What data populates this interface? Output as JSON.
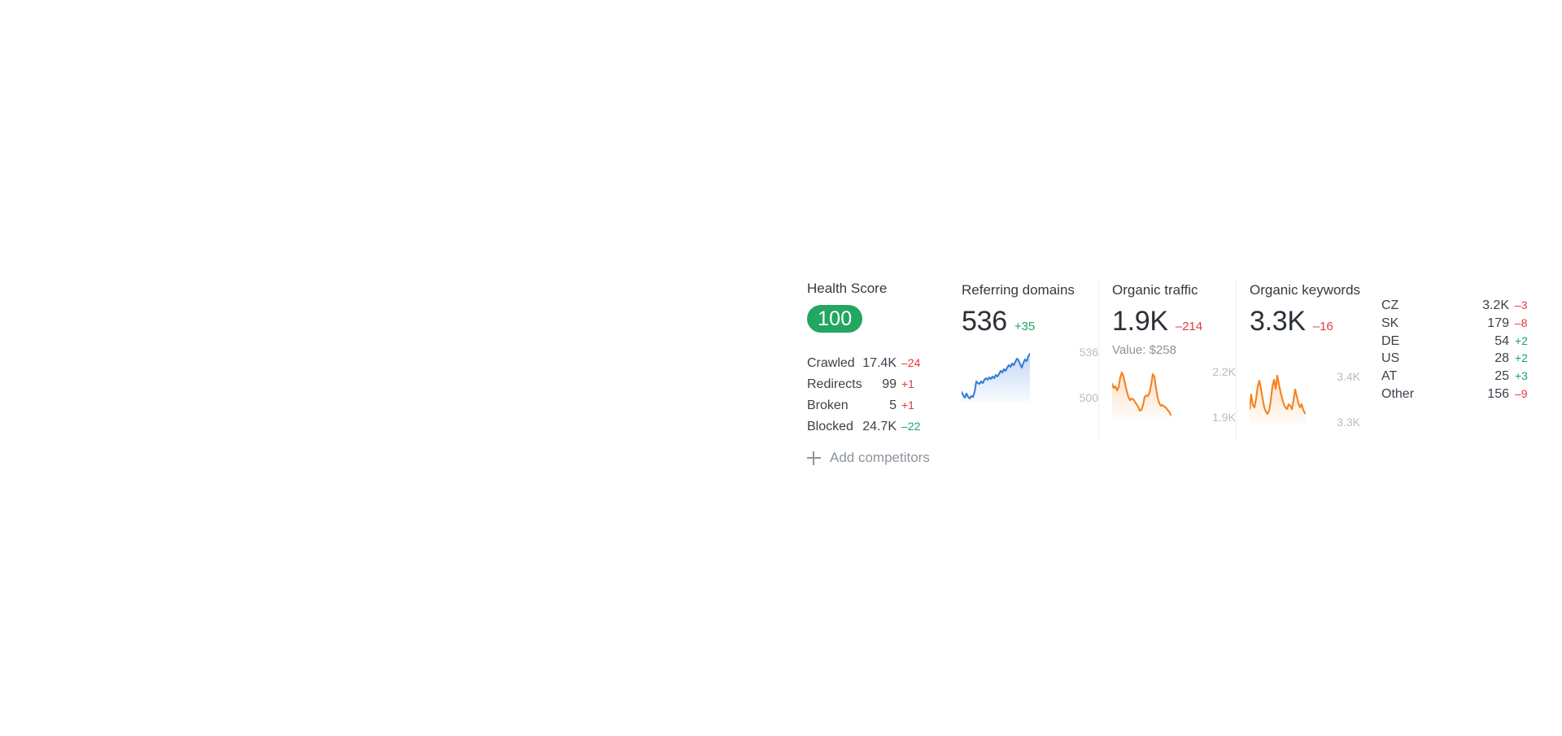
{
  "health": {
    "title": "Health Score",
    "score": "100",
    "score_color": "#22a661",
    "stats": [
      {
        "label": "Crawled",
        "value": "17.4K",
        "delta": "–24",
        "dir": "down"
      },
      {
        "label": "Redirects",
        "value": "99",
        "delta": "+1",
        "dir": "down"
      },
      {
        "label": "Broken",
        "value": "5",
        "delta": "+1",
        "dir": "down"
      },
      {
        "label": "Blocked",
        "value": "24.7K",
        "delta": "–22",
        "dir": "up"
      }
    ],
    "add_competitors": "Add competitors"
  },
  "referring_domains": {
    "title": "Referring domains",
    "value": "536",
    "delta": "+35",
    "dir": "up",
    "axis_high": "536",
    "axis_low": "500"
  },
  "organic_traffic": {
    "title": "Organic traffic",
    "value": "1.9K",
    "delta": "–214",
    "dir": "down",
    "sub": "Value: $258",
    "axis_high": "2.2K",
    "axis_low": "1.9K"
  },
  "organic_keywords": {
    "title": "Organic keywords",
    "value": "3.3K",
    "delta": "–16",
    "dir": "down",
    "axis_high": "3.4K",
    "axis_low": "3.3K",
    "countries": [
      {
        "name": "CZ",
        "value": "3.2K",
        "delta": "–3",
        "dir": "down"
      },
      {
        "name": "SK",
        "value": "179",
        "delta": "–8",
        "dir": "down"
      },
      {
        "name": "DE",
        "value": "54",
        "delta": "+2",
        "dir": "up"
      },
      {
        "name": "US",
        "value": "28",
        "delta": "+2",
        "dir": "up"
      },
      {
        "name": "AT",
        "value": "25",
        "delta": "+3",
        "dir": "up"
      },
      {
        "name": "Other",
        "value": "156",
        "delta": "–9",
        "dir": "down"
      }
    ]
  },
  "chart_data": [
    {
      "type": "area",
      "title": "Referring domains",
      "ylim": [
        500,
        536
      ],
      "color": "#3b7dd8",
      "values": [
        508,
        505,
        502,
        506,
        503,
        501,
        504,
        503,
        508,
        513,
        512,
        511,
        513,
        512,
        514,
        515,
        514,
        516,
        515,
        517,
        516,
        518,
        517,
        519,
        521,
        520,
        522,
        521,
        523,
        525,
        524,
        526,
        525,
        527,
        529,
        528,
        526,
        524,
        527,
        529,
        528,
        530,
        529,
        531,
        530,
        532,
        534,
        533,
        535,
        536
      ]
    },
    {
      "type": "area",
      "title": "Organic traffic",
      "ylim": [
        1900,
        2200
      ],
      "color": "#f58220",
      "values": [
        2110,
        2090,
        2095,
        2070,
        2085,
        2150,
        2190,
        2160,
        2110,
        2060,
        2020,
        1995,
        2010,
        2005,
        1985,
        1970,
        1950,
        1925,
        1930,
        1960,
        2020,
        2030,
        2025,
        2045,
        2100,
        2180,
        2160,
        2080,
        2010,
        1975,
        1955,
        1960,
        1950,
        1945,
        1930,
        1920,
        1905
      ]
    },
    {
      "type": "area",
      "title": "Organic keywords",
      "ylim": [
        3300,
        3400
      ],
      "color": "#f58220",
      "values": [
        3320,
        3355,
        3330,
        3325,
        3345,
        3375,
        3390,
        3370,
        3345,
        3325,
        3315,
        3310,
        3318,
        3340,
        3375,
        3392,
        3370,
        3400,
        3382,
        3360,
        3345,
        3330,
        3322,
        3318,
        3330,
        3325,
        3318,
        3340,
        3365,
        3350,
        3332,
        3322,
        3330,
        3318,
        3312
      ]
    }
  ]
}
